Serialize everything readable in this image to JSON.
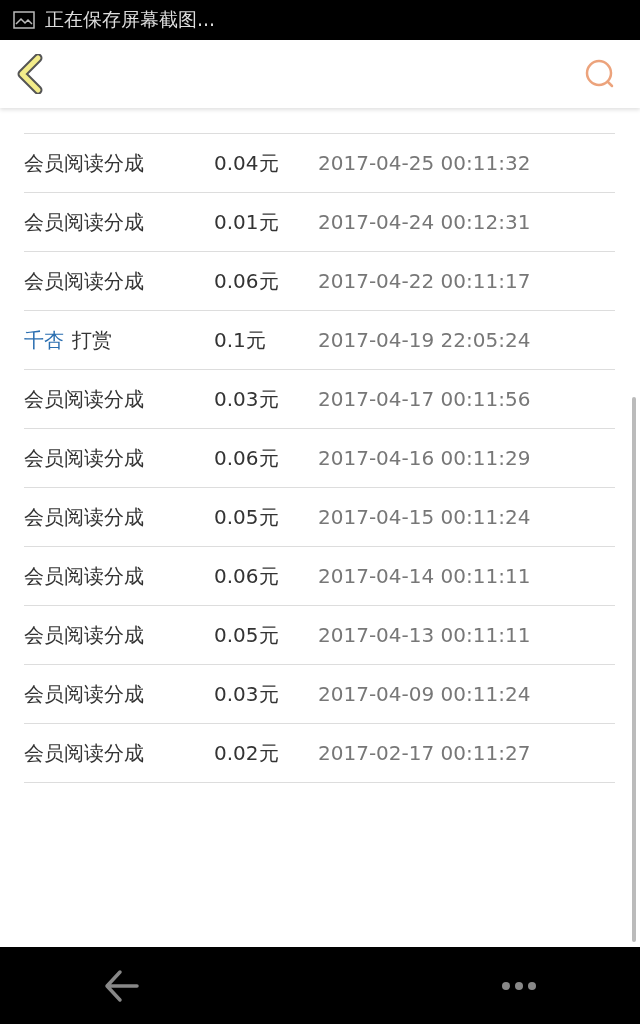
{
  "status_bar": {
    "notification": "正在保存屏幕截图..."
  },
  "records": [
    {
      "kind": "plain",
      "label": "会员阅读分成",
      "amount": "0.04元",
      "time": "2017-04-25 00:11:32"
    },
    {
      "kind": "plain",
      "label": "会员阅读分成",
      "amount": "0.01元",
      "time": "2017-04-24 00:12:31"
    },
    {
      "kind": "plain",
      "label": "会员阅读分成",
      "amount": "0.06元",
      "time": "2017-04-22 00:11:17"
    },
    {
      "kind": "tip",
      "user": "千杏",
      "label": "打赏",
      "amount": "0.1元",
      "time": "2017-04-19 22:05:24"
    },
    {
      "kind": "plain",
      "label": "会员阅读分成",
      "amount": "0.03元",
      "time": "2017-04-17 00:11:56"
    },
    {
      "kind": "plain",
      "label": "会员阅读分成",
      "amount": "0.06元",
      "time": "2017-04-16 00:11:29"
    },
    {
      "kind": "plain",
      "label": "会员阅读分成",
      "amount": "0.05元",
      "time": "2017-04-15 00:11:24"
    },
    {
      "kind": "plain",
      "label": "会员阅读分成",
      "amount": "0.06元",
      "time": "2017-04-14 00:11:11"
    },
    {
      "kind": "plain",
      "label": "会员阅读分成",
      "amount": "0.05元",
      "time": "2017-04-13 00:11:11"
    },
    {
      "kind": "plain",
      "label": "会员阅读分成",
      "amount": "0.03元",
      "time": "2017-04-09 00:11:24"
    },
    {
      "kind": "plain",
      "label": "会员阅读分成",
      "amount": "0.02元",
      "time": "2017-02-17 00:11:27"
    }
  ]
}
